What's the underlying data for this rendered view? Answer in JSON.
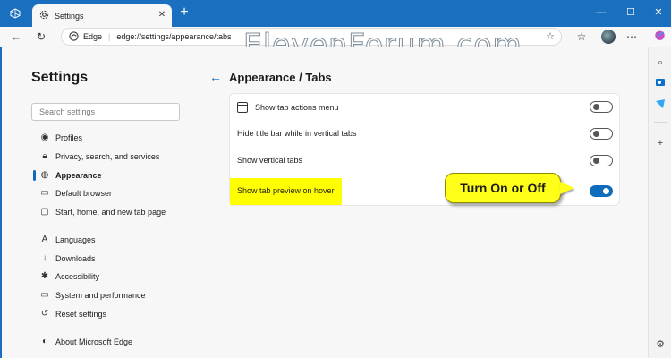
{
  "browser": {
    "tab_title": "Settings",
    "address_brand": "Edge",
    "address_url": "edge://settings/appearance/tabs",
    "icons": {
      "workspaces": "workspaces-icon",
      "tab_actions": "tab-actions-icon",
      "settings": "gear-icon",
      "close": "close-icon",
      "new_tab": "plus-icon",
      "back": "arrow-left-icon",
      "refresh": "refresh-icon",
      "favorite": "star-icon"
    }
  },
  "watermark": "ElevenForum.com",
  "sidebar": {
    "title": "Settings",
    "search_placeholder": "Search settings",
    "items": [
      {
        "label": "Profiles",
        "icon": "profile-icon"
      },
      {
        "label": "Privacy, search, and services",
        "icon": "lock-icon"
      },
      {
        "label": "Appearance",
        "icon": "palette-icon",
        "active": true
      },
      {
        "label": "Default browser",
        "icon": "browser-icon"
      },
      {
        "label": "Start, home, and new tab page",
        "icon": "home-icon"
      },
      {
        "label": "Languages",
        "icon": "language-icon"
      },
      {
        "label": "Downloads",
        "icon": "download-icon"
      },
      {
        "label": "Accessibility",
        "icon": "accessibility-icon"
      },
      {
        "label": "System and performance",
        "icon": "monitor-icon"
      },
      {
        "label": "Reset settings",
        "icon": "reset-icon"
      },
      {
        "label": "About Microsoft Edge",
        "icon": "edge-icon"
      }
    ]
  },
  "page": {
    "title": "Appearance / Tabs",
    "rows": [
      {
        "label": "Show tab actions menu",
        "on": false
      },
      {
        "label": "Hide title bar while in vertical tabs",
        "on": false
      },
      {
        "label": "Show vertical tabs",
        "on": false
      },
      {
        "label": "Show tab preview on hover",
        "on": true
      }
    ]
  },
  "callout": "Turn On or Off",
  "colors": {
    "accent": "#0f6cbd",
    "titlebar": "#1a6fbf",
    "highlight": "#ffff00"
  }
}
